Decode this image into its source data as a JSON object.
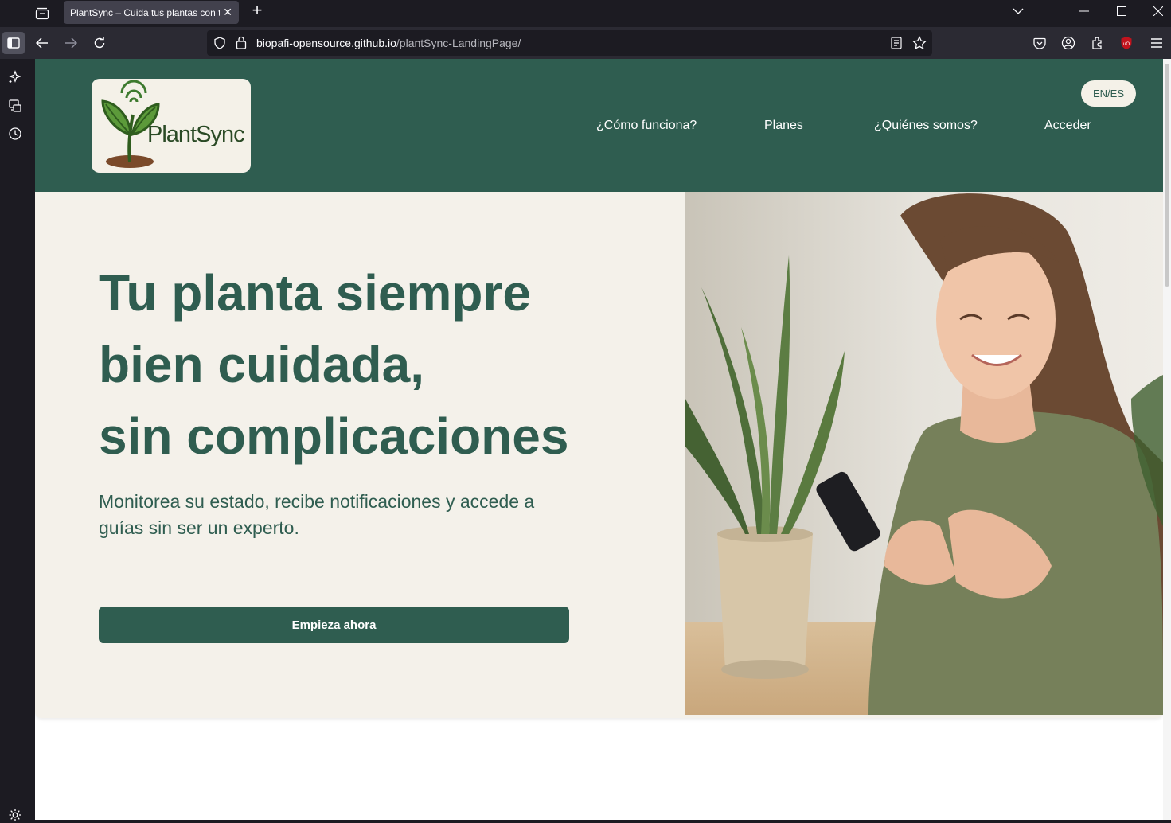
{
  "browser": {
    "tab_title": "PlantSync – Cuida tus plantas con te",
    "url_domain": "biopafi-opensource.github.io",
    "url_path": "/plantSync-LandingPage/",
    "icons": [
      "tab-list-icon",
      "close-icon",
      "plus-icon",
      "chevron-down-icon",
      "minimize-icon",
      "maximize-icon",
      "window-close-icon",
      "sidebar-icon",
      "back-arrow-icon",
      "forward-arrow-icon",
      "reload-icon",
      "shield-icon",
      "lock-icon",
      "reader-view-icon",
      "star-icon",
      "pocket-icon",
      "account-icon",
      "extensions-icon",
      "ublock-icon",
      "hamburger-menu-icon",
      "sparkle-icon",
      "synced-tabs-icon",
      "history-icon",
      "settings-icon"
    ]
  },
  "site": {
    "logo_text": "PlantSync",
    "lang_toggle": "EN/ES",
    "nav": [
      {
        "label": "¿Cómo funciona?"
      },
      {
        "label": "Planes"
      },
      {
        "label": "¿Quiénes somos?"
      },
      {
        "label": "Acceder"
      }
    ]
  },
  "hero": {
    "title_lines": [
      "Tu planta siempre",
      "bien cuidada,",
      "sin complicaciones"
    ],
    "subtitle": "Monitorea su estado, recibe notificaciones y accede a guías sin ser un experto.",
    "cta_label": "Empieza ahora"
  },
  "colors": {
    "brand_green": "#2f5d50",
    "hero_bg": "#f4f1ea",
    "logo_bg": "#f4f1e8",
    "browser_dark": "#1c1b22"
  }
}
